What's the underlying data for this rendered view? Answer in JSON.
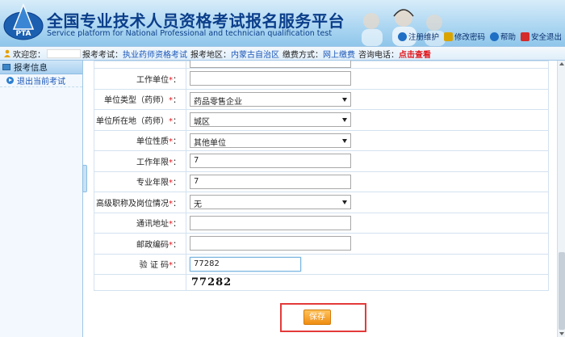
{
  "header": {
    "title": "全国专业技术人员资格考试报名服务平台",
    "subtitle": "Service platform for National Professional and technician qualification test",
    "logo_text": "PTA",
    "links": [
      {
        "label": "注册维护",
        "icon": "globe-icon",
        "color": "#1f6fc4"
      },
      {
        "label": "修改密码",
        "icon": "lock-icon",
        "color": "#d9a400"
      },
      {
        "label": "帮助",
        "icon": "help-icon",
        "color": "#1f6fc4"
      },
      {
        "label": "安全退出",
        "icon": "power-icon",
        "color": "#d42b2b"
      }
    ]
  },
  "infobar": {
    "welcome_label": "欢迎您：",
    "exam_label": "报考考试：",
    "exam_value": "执业药师资格考试",
    "region_label": "报考地区：",
    "region_value": "内蒙古自治区",
    "payment_label": "缴费方式：",
    "payment_value": "网上缴费",
    "phone_label": "咨询电话：",
    "phone_link": "点击查看"
  },
  "sidebar": {
    "section_title": "报考信息",
    "items": [
      {
        "label": "退出当前考试"
      }
    ]
  },
  "form": {
    "rows": [
      {
        "label": "",
        "required": false,
        "type": "select",
        "value": ""
      },
      {
        "label": "工作单位",
        "required": true,
        "type": "input",
        "value": ""
      },
      {
        "label": "单位类型（药师）",
        "required": true,
        "type": "select",
        "value": "药品零售企业"
      },
      {
        "label": "单位所在地（药师）",
        "required": true,
        "type": "select",
        "value": "城区"
      },
      {
        "label": "单位性质",
        "required": true,
        "type": "select",
        "value": "其他单位"
      },
      {
        "label": "工作年限",
        "required": true,
        "type": "input",
        "value": "7"
      },
      {
        "label": "专业年限",
        "required": true,
        "type": "input",
        "value": "7"
      },
      {
        "label": "高级职称及岗位情况",
        "required": true,
        "type": "select",
        "value": "无"
      },
      {
        "label": "通讯地址",
        "required": true,
        "type": "input",
        "value": ""
      },
      {
        "label": "邮政编码",
        "required": true,
        "type": "input",
        "value": ""
      },
      {
        "label": "验 证 码",
        "required": true,
        "type": "captcha-input",
        "value": "77282"
      }
    ],
    "required_mark": "*",
    "label_suffix": "：",
    "captcha_image_text": "77282"
  },
  "actions": {
    "save_label": "保存"
  },
  "colors": {
    "title_blue": "#0b3e8a",
    "link_blue": "#1a56b8",
    "alert_red": "#e1151b",
    "save_orange": "#ef8d12",
    "highlight_red": "#e43a3a"
  }
}
